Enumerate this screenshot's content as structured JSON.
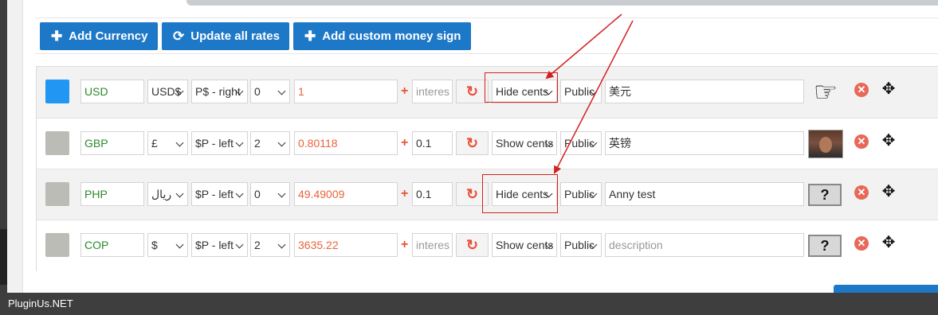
{
  "toolbar": {
    "add_currency_label": "Add Currency",
    "update_rates_label": "Update all rates",
    "add_sign_label": "Add custom money sign"
  },
  "colors": {
    "primary": "#1e78c8",
    "active_swatch": "#2196f3",
    "inactive_swatch": "#bcbcb6",
    "code_text": "#2a8a2a",
    "rate_text": "#e8633a",
    "annotation": "#d42020"
  },
  "rows": [
    {
      "code": "USD",
      "sign": "USD$",
      "position": "P$ - right",
      "decimals": "0",
      "rate": "1",
      "interest": "interes",
      "cents": "Hide cents",
      "visibility": "Public",
      "description": "美元",
      "flag": "hand-pointer-icon",
      "swatch_color": "#2196f3"
    },
    {
      "code": "GBP",
      "sign": "£",
      "position": "$P - left",
      "decimals": "2",
      "rate": "0.80118",
      "interest": "0.1",
      "cents": "Show cents",
      "visibility": "Public",
      "description": "英镑",
      "flag": "photo-icon",
      "swatch_color": "#bcbcb6"
    },
    {
      "code": "PHP",
      "sign": "ريال",
      "position": "$P - left",
      "decimals": "0",
      "rate": "49.49009",
      "interest": "0.1",
      "cents": "Hide cents",
      "visibility": "Public",
      "description": "Anny test",
      "flag": "question-flag-icon",
      "swatch_color": "#bcbcb6"
    },
    {
      "code": "COP",
      "sign": "$",
      "position": "$P - left",
      "decimals": "2",
      "rate": "3635.22",
      "interest": "interes",
      "cents": "Show cents",
      "visibility": "Public",
      "description": "description",
      "flag": "question-flag-icon",
      "swatch_color": "#bcbcb6"
    }
  ],
  "icons": {
    "refresh": "↻",
    "delete": "✕",
    "move": "✥",
    "plus": "+",
    "question": "?"
  },
  "footer": {
    "brand": "PluginUs.NET"
  }
}
